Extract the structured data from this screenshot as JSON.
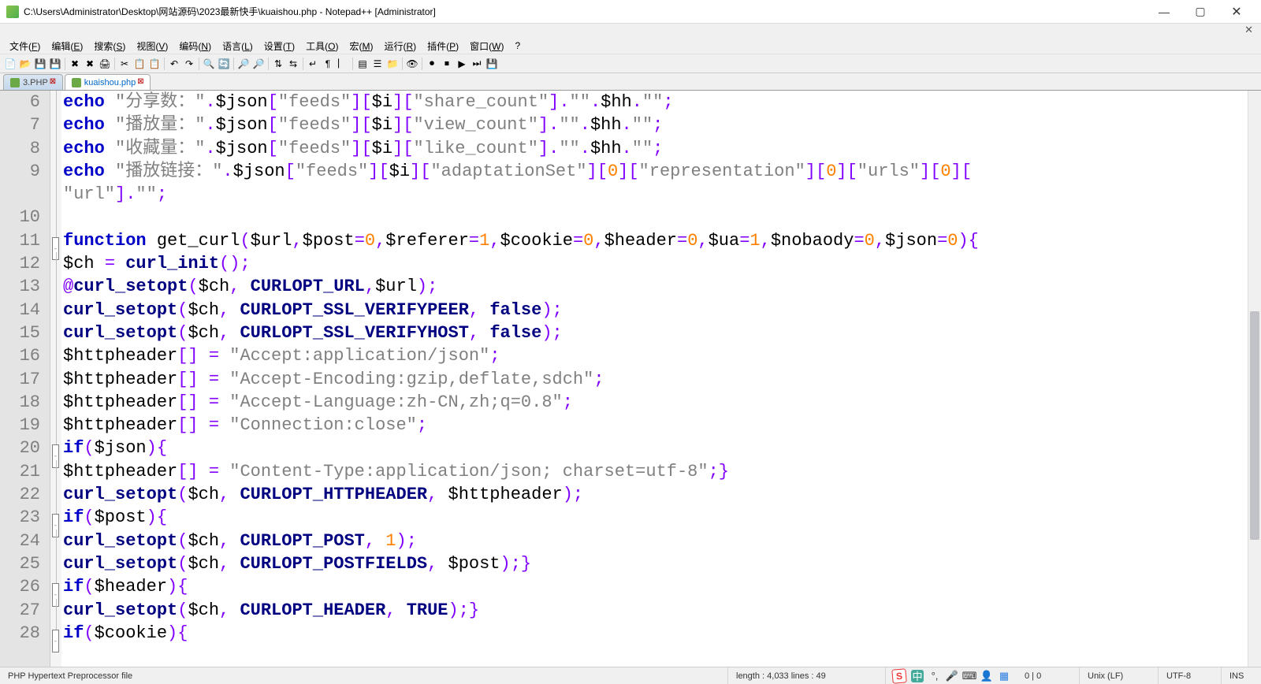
{
  "title": "C:\\Users\\Administrator\\Desktop\\网站源码\\2023最新快手\\kuaishou.php - Notepad++ [Administrator]",
  "menus": [
    "文件(F)",
    "编辑(E)",
    "搜索(S)",
    "视图(V)",
    "编码(N)",
    "语言(L)",
    "设置(T)",
    "工具(O)",
    "宏(M)",
    "运行(R)",
    "插件(P)",
    "窗口(W)",
    "?"
  ],
  "tabs": [
    {
      "label": "3.PHP",
      "active": false
    },
    {
      "label": "kuaishou.php",
      "active": true
    }
  ],
  "gutter_start": 6,
  "gutter_end": 28,
  "fold_markers": {
    "11": "open",
    "20": "open",
    "23": "open",
    "26": "open",
    "28": "open"
  },
  "code_lines": [
    [
      [
        "kw",
        "echo"
      ],
      [
        "",
        ""
      ],
      [
        "str",
        "\"分享数：\""
      ],
      [
        "op",
        "."
      ],
      [
        "var",
        "$json"
      ],
      [
        "op",
        "["
      ],
      [
        "str",
        "\"feeds\""
      ],
      [
        "op",
        "]["
      ],
      [
        "var",
        "$i"
      ],
      [
        "op",
        "]["
      ],
      [
        "str",
        "\"share_count\""
      ],
      [
        "op",
        "]."
      ],
      [
        "str",
        "\"\""
      ],
      [
        "op",
        "."
      ],
      [
        "var",
        "$hh"
      ],
      [
        "op",
        "."
      ],
      [
        "str",
        "\"\""
      ],
      [
        "op",
        ";"
      ]
    ],
    [
      [
        "kw",
        "echo"
      ],
      [
        "",
        ""
      ],
      [
        "str",
        "\"播放量：\""
      ],
      [
        "op",
        "."
      ],
      [
        "var",
        "$json"
      ],
      [
        "op",
        "["
      ],
      [
        "str",
        "\"feeds\""
      ],
      [
        "op",
        "]["
      ],
      [
        "var",
        "$i"
      ],
      [
        "op",
        "]["
      ],
      [
        "str",
        "\"view_count\""
      ],
      [
        "op",
        "]."
      ],
      [
        "str",
        "\"\""
      ],
      [
        "op",
        "."
      ],
      [
        "var",
        "$hh"
      ],
      [
        "op",
        "."
      ],
      [
        "str",
        "\"\""
      ],
      [
        "op",
        ";"
      ]
    ],
    [
      [
        "kw",
        "echo"
      ],
      [
        "",
        ""
      ],
      [
        "str",
        "\"收藏量：\""
      ],
      [
        "op",
        "."
      ],
      [
        "var",
        "$json"
      ],
      [
        "op",
        "["
      ],
      [
        "str",
        "\"feeds\""
      ],
      [
        "op",
        "]["
      ],
      [
        "var",
        "$i"
      ],
      [
        "op",
        "]["
      ],
      [
        "str",
        "\"like_count\""
      ],
      [
        "op",
        "]."
      ],
      [
        "str",
        "\"\""
      ],
      [
        "op",
        "."
      ],
      [
        "var",
        "$hh"
      ],
      [
        "op",
        "."
      ],
      [
        "str",
        "\"\""
      ],
      [
        "op",
        ";"
      ]
    ],
    [
      [
        "kw",
        "echo"
      ],
      [
        "",
        ""
      ],
      [
        "str",
        "\"播放链接：\""
      ],
      [
        "op",
        "."
      ],
      [
        "var",
        "$json"
      ],
      [
        "op",
        "["
      ],
      [
        "str",
        "\"feeds\""
      ],
      [
        "op",
        "]["
      ],
      [
        "var",
        "$i"
      ],
      [
        "op",
        "]["
      ],
      [
        "str",
        "\"adaptationSet\""
      ],
      [
        "op",
        "]["
      ],
      [
        "num",
        "0"
      ],
      [
        "op",
        "]["
      ],
      [
        "str",
        "\"representation\""
      ],
      [
        "op",
        "]["
      ],
      [
        "num",
        "0"
      ],
      [
        "op",
        "]["
      ],
      [
        "str",
        "\"urls\""
      ],
      [
        "op",
        "]["
      ],
      [
        "num",
        "0"
      ],
      [
        "op",
        "]["
      ]
    ],
    [
      [
        "str",
        "\"url\""
      ],
      [
        "op",
        "]."
      ],
      [
        "str",
        "\"\""
      ],
      [
        "op",
        ";"
      ]
    ],
    [],
    [
      [
        "kw",
        "function"
      ],
      [
        "",
        " "
      ],
      [
        "var",
        "get_curl"
      ],
      [
        "op",
        "("
      ],
      [
        "var",
        "$url"
      ],
      [
        "op",
        ","
      ],
      [
        "var",
        "$post"
      ],
      [
        "op",
        "="
      ],
      [
        "num",
        "0"
      ],
      [
        "op",
        ","
      ],
      [
        "var",
        "$referer"
      ],
      [
        "op",
        "="
      ],
      [
        "num",
        "1"
      ],
      [
        "op",
        ","
      ],
      [
        "var",
        "$cookie"
      ],
      [
        "op",
        "="
      ],
      [
        "num",
        "0"
      ],
      [
        "op",
        ","
      ],
      [
        "var",
        "$header"
      ],
      [
        "op",
        "="
      ],
      [
        "num",
        "0"
      ],
      [
        "op",
        ","
      ],
      [
        "var",
        "$ua"
      ],
      [
        "op",
        "="
      ],
      [
        "num",
        "1"
      ],
      [
        "op",
        ","
      ],
      [
        "var",
        "$nobaody"
      ],
      [
        "op",
        "="
      ],
      [
        "num",
        "0"
      ],
      [
        "op",
        ","
      ],
      [
        "var",
        "$json"
      ],
      [
        "op",
        "="
      ],
      [
        "num",
        "0"
      ],
      [
        "op",
        ")"
      ],
      [
        "brk",
        "{"
      ]
    ],
    [
      [
        "var",
        "$ch"
      ],
      [
        "",
        " "
      ],
      [
        "op",
        "="
      ],
      [
        "",
        " "
      ],
      [
        "func",
        "curl_init"
      ],
      [
        "op",
        "();"
      ]
    ],
    [
      [
        "op",
        "@"
      ],
      [
        "func",
        "curl_setopt"
      ],
      [
        "op",
        "("
      ],
      [
        "var",
        "$ch"
      ],
      [
        "op",
        ", "
      ],
      [
        "const",
        "CURLOPT_URL"
      ],
      [
        "op",
        ","
      ],
      [
        "var",
        "$url"
      ],
      [
        "op",
        ");"
      ]
    ],
    [
      [
        "func",
        "curl_setopt"
      ],
      [
        "op",
        "("
      ],
      [
        "var",
        "$ch"
      ],
      [
        "op",
        ", "
      ],
      [
        "const",
        "CURLOPT_SSL_VERIFYPEER"
      ],
      [
        "op",
        ", "
      ],
      [
        "bool",
        "false"
      ],
      [
        "op",
        ");"
      ]
    ],
    [
      [
        "func",
        "curl_setopt"
      ],
      [
        "op",
        "("
      ],
      [
        "var",
        "$ch"
      ],
      [
        "op",
        ", "
      ],
      [
        "const",
        "CURLOPT_SSL_VERIFYHOST"
      ],
      [
        "op",
        ", "
      ],
      [
        "bool",
        "false"
      ],
      [
        "op",
        ");"
      ]
    ],
    [
      [
        "var",
        "$httpheader"
      ],
      [
        "op",
        "[] = "
      ],
      [
        "str",
        "\"Accept:application/json\""
      ],
      [
        "op",
        ";"
      ]
    ],
    [
      [
        "var",
        "$httpheader"
      ],
      [
        "op",
        "[] = "
      ],
      [
        "str",
        "\"Accept-Encoding:gzip,deflate,sdch\""
      ],
      [
        "op",
        ";"
      ]
    ],
    [
      [
        "var",
        "$httpheader"
      ],
      [
        "op",
        "[] = "
      ],
      [
        "str",
        "\"Accept-Language:zh-CN,zh;q=0.8\""
      ],
      [
        "op",
        ";"
      ]
    ],
    [
      [
        "var",
        "$httpheader"
      ],
      [
        "op",
        "[] = "
      ],
      [
        "str",
        "\"Connection:close\""
      ],
      [
        "op",
        ";"
      ]
    ],
    [
      [
        "kw",
        "if"
      ],
      [
        "op",
        "("
      ],
      [
        "var",
        "$json"
      ],
      [
        "op",
        ")"
      ],
      [
        "brk",
        "{"
      ]
    ],
    [
      [
        "var",
        "$httpheader"
      ],
      [
        "op",
        "[] = "
      ],
      [
        "str",
        "\"Content-Type:application/json; charset=utf-8\""
      ],
      [
        "op",
        ";"
      ],
      [
        "brk",
        "}"
      ]
    ],
    [
      [
        "func",
        "curl_setopt"
      ],
      [
        "op",
        "("
      ],
      [
        "var",
        "$ch"
      ],
      [
        "op",
        ", "
      ],
      [
        "const",
        "CURLOPT_HTTPHEADER"
      ],
      [
        "op",
        ", "
      ],
      [
        "var",
        "$httpheader"
      ],
      [
        "op",
        ");"
      ]
    ],
    [
      [
        "kw",
        "if"
      ],
      [
        "op",
        "("
      ],
      [
        "var",
        "$post"
      ],
      [
        "op",
        ")"
      ],
      [
        "brk",
        "{"
      ]
    ],
    [
      [
        "func",
        "curl_setopt"
      ],
      [
        "op",
        "("
      ],
      [
        "var",
        "$ch"
      ],
      [
        "op",
        ", "
      ],
      [
        "const",
        "CURLOPT_POST"
      ],
      [
        "op",
        ", "
      ],
      [
        "num",
        "1"
      ],
      [
        "op",
        ");"
      ]
    ],
    [
      [
        "func",
        "curl_setopt"
      ],
      [
        "op",
        "("
      ],
      [
        "var",
        "$ch"
      ],
      [
        "op",
        ", "
      ],
      [
        "const",
        "CURLOPT_POSTFIELDS"
      ],
      [
        "op",
        ", "
      ],
      [
        "var",
        "$post"
      ],
      [
        "op",
        ");"
      ],
      [
        "brk",
        "}"
      ]
    ],
    [
      [
        "kw",
        "if"
      ],
      [
        "op",
        "("
      ],
      [
        "var",
        "$header"
      ],
      [
        "op",
        ")"
      ],
      [
        "brk",
        "{"
      ]
    ],
    [
      [
        "func",
        "curl_setopt"
      ],
      [
        "op",
        "("
      ],
      [
        "var",
        "$ch"
      ],
      [
        "op",
        ", "
      ],
      [
        "const",
        "CURLOPT_HEADER"
      ],
      [
        "op",
        ", "
      ],
      [
        "bool",
        "TRUE"
      ],
      [
        "op",
        ");"
      ],
      [
        "brk",
        "}"
      ]
    ],
    [
      [
        "kw",
        "if"
      ],
      [
        "op",
        "("
      ],
      [
        "var",
        "$cookie"
      ],
      [
        "op",
        ")"
      ],
      [
        "brk",
        "{"
      ]
    ]
  ],
  "status": {
    "filetype": "PHP Hypertext Preprocessor file",
    "length": "length : 4,033    lines : 49",
    "sel": "0 | 0",
    "eol": "Unix (LF)",
    "encoding": "UTF-8",
    "mode": "INS"
  },
  "tray_labels": {
    "ime": "中"
  }
}
